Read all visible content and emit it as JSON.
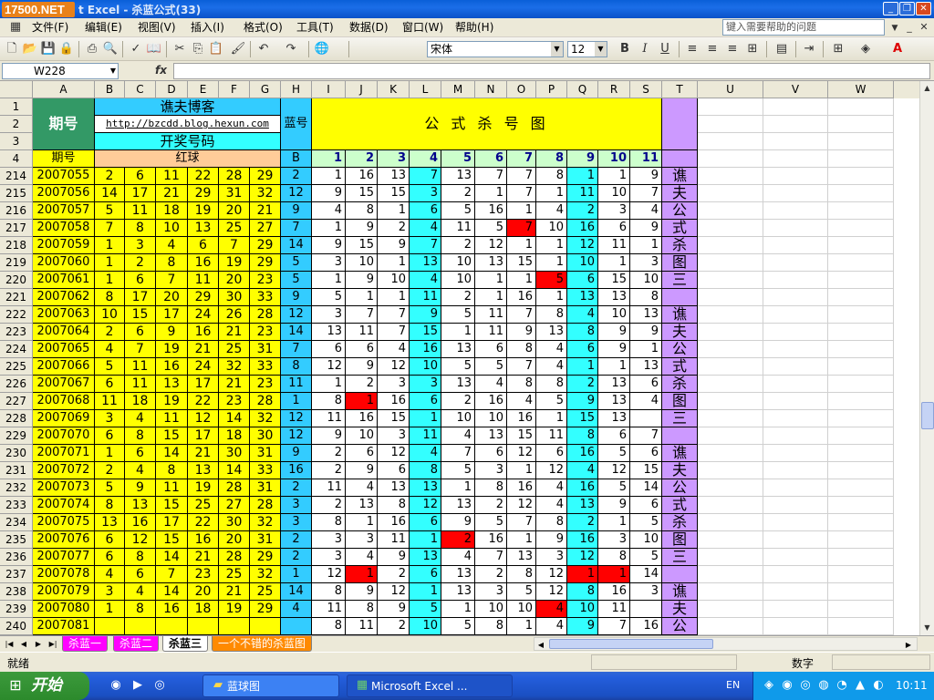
{
  "window": {
    "brand": "17500.NET",
    "title": "t Excel - 杀蓝公式(33)"
  },
  "menu": {
    "items": [
      "文件(F)",
      "编辑(E)",
      "视图(V)",
      "插入(I)",
      "格式(O)",
      "工具(T)",
      "数据(D)",
      "窗口(W)",
      "帮助(H)"
    ],
    "help_placeholder": "键入需要帮助的问题"
  },
  "toolbar": {
    "font": "宋体",
    "size": "12",
    "bold": "B",
    "italic": "I",
    "underline": "U"
  },
  "formula": {
    "cell_ref": "W228",
    "fx": "fx",
    "value": ""
  },
  "columns": [
    "A",
    "B",
    "C",
    "D",
    "E",
    "F",
    "G",
    "H",
    "I",
    "J",
    "K",
    "L",
    "M",
    "N",
    "O",
    "P",
    "Q",
    "R",
    "S",
    "T",
    "U",
    "V",
    "W"
  ],
  "header": {
    "r1": "1",
    "r2": "2",
    "r3": "3",
    "r4": "4",
    "period": "期号",
    "blog": "谯夫博客",
    "url": "http://bzcdd.blog.hexun.com",
    "draw": "开奖号码",
    "blue": "蓝号",
    "formula_title": "公 式 杀 号 图",
    "period2": "期号",
    "red": "红球",
    "b": "B",
    "nums": [
      "1",
      "2",
      "3",
      "4",
      "5",
      "6",
      "7",
      "8",
      "9",
      "10",
      "11"
    ]
  },
  "rows": [
    {
      "r": "214",
      "p": "2007055",
      "red": [
        "2",
        "6",
        "11",
        "22",
        "28",
        "29"
      ],
      "b": "2",
      "n": [
        "1",
        "16",
        "13",
        "7",
        "13",
        "7",
        "7",
        "8",
        "1",
        "1",
        "9"
      ],
      "hl": []
    },
    {
      "r": "215",
      "p": "2007056",
      "red": [
        "14",
        "17",
        "21",
        "29",
        "31",
        "32"
      ],
      "b": "12",
      "n": [
        "9",
        "15",
        "15",
        "3",
        "2",
        "1",
        "7",
        "1",
        "11",
        "10",
        "7"
      ],
      "hl": []
    },
    {
      "r": "216",
      "p": "2007057",
      "red": [
        "5",
        "11",
        "18",
        "19",
        "20",
        "21"
      ],
      "b": "9",
      "n": [
        "4",
        "8",
        "1",
        "6",
        "5",
        "16",
        "1",
        "4",
        "2",
        "3",
        "4"
      ],
      "hl": []
    },
    {
      "r": "217",
      "p": "2007058",
      "red": [
        "7",
        "8",
        "10",
        "13",
        "25",
        "27"
      ],
      "b": "7",
      "n": [
        "1",
        "9",
        "2",
        "4",
        "11",
        "5",
        "7",
        "10",
        "16",
        "6",
        "9"
      ],
      "hl": [
        6
      ]
    },
    {
      "r": "218",
      "p": "2007059",
      "red": [
        "1",
        "3",
        "4",
        "6",
        "7",
        "29"
      ],
      "b": "14",
      "n": [
        "9",
        "15",
        "9",
        "7",
        "2",
        "12",
        "1",
        "1",
        "12",
        "11",
        "1"
      ],
      "hl": []
    },
    {
      "r": "219",
      "p": "2007060",
      "red": [
        "1",
        "2",
        "8",
        "16",
        "19",
        "29"
      ],
      "b": "5",
      "n": [
        "3",
        "10",
        "1",
        "13",
        "10",
        "13",
        "15",
        "1",
        "10",
        "1",
        "3"
      ],
      "hl": []
    },
    {
      "r": "220",
      "p": "2007061",
      "red": [
        "1",
        "6",
        "7",
        "11",
        "20",
        "23"
      ],
      "b": "5",
      "n": [
        "1",
        "9",
        "10",
        "4",
        "10",
        "1",
        "1",
        "5",
        "6",
        "15",
        "10"
      ],
      "hl": [
        7
      ]
    },
    {
      "r": "221",
      "p": "2007062",
      "red": [
        "8",
        "17",
        "20",
        "29",
        "30",
        "33"
      ],
      "b": "9",
      "n": [
        "5",
        "1",
        "1",
        "11",
        "2",
        "1",
        "16",
        "1",
        "13",
        "13",
        "8"
      ],
      "hl": []
    },
    {
      "r": "222",
      "p": "2007063",
      "red": [
        "10",
        "15",
        "17",
        "24",
        "26",
        "28"
      ],
      "b": "12",
      "n": [
        "3",
        "7",
        "7",
        "9",
        "5",
        "11",
        "7",
        "8",
        "4",
        "10",
        "13"
      ],
      "hl": []
    },
    {
      "r": "223",
      "p": "2007064",
      "red": [
        "2",
        "6",
        "9",
        "16",
        "21",
        "23"
      ],
      "b": "14",
      "n": [
        "13",
        "11",
        "7",
        "15",
        "1",
        "11",
        "9",
        "13",
        "8",
        "9",
        "9"
      ],
      "hl": []
    },
    {
      "r": "224",
      "p": "2007065",
      "red": [
        "4",
        "7",
        "19",
        "21",
        "25",
        "31"
      ],
      "b": "7",
      "n": [
        "6",
        "6",
        "4",
        "16",
        "13",
        "6",
        "8",
        "4",
        "6",
        "9",
        "1"
      ],
      "hl": []
    },
    {
      "r": "225",
      "p": "2007066",
      "red": [
        "5",
        "11",
        "16",
        "24",
        "32",
        "33"
      ],
      "b": "8",
      "n": [
        "12",
        "9",
        "12",
        "10",
        "5",
        "5",
        "7",
        "4",
        "1",
        "1",
        "13"
      ],
      "hl": []
    },
    {
      "r": "226",
      "p": "2007067",
      "red": [
        "6",
        "11",
        "13",
        "17",
        "21",
        "23"
      ],
      "b": "11",
      "n": [
        "1",
        "2",
        "3",
        "3",
        "13",
        "4",
        "8",
        "8",
        "2",
        "13",
        "6"
      ],
      "hl": []
    },
    {
      "r": "227",
      "p": "2007068",
      "red": [
        "11",
        "18",
        "19",
        "22",
        "23",
        "28"
      ],
      "b": "1",
      "n": [
        "8",
        "1",
        "16",
        "6",
        "2",
        "16",
        "4",
        "5",
        "9",
        "13",
        "4"
      ],
      "hl": [
        1
      ]
    },
    {
      "r": "228",
      "p": "2007069",
      "red": [
        "3",
        "4",
        "11",
        "12",
        "14",
        "32"
      ],
      "b": "12",
      "n": [
        "11",
        "16",
        "15",
        "1",
        "10",
        "10",
        "16",
        "1",
        "15",
        "13",
        ""
      ],
      "hl": []
    },
    {
      "r": "229",
      "p": "2007070",
      "red": [
        "6",
        "8",
        "15",
        "17",
        "18",
        "30"
      ],
      "b": "12",
      "n": [
        "9",
        "10",
        "3",
        "11",
        "4",
        "13",
        "15",
        "11",
        "8",
        "6",
        "7"
      ],
      "hl": []
    },
    {
      "r": "230",
      "p": "2007071",
      "red": [
        "1",
        "6",
        "14",
        "21",
        "30",
        "31"
      ],
      "b": "9",
      "n": [
        "2",
        "6",
        "12",
        "4",
        "7",
        "6",
        "12",
        "6",
        "16",
        "5",
        "6"
      ],
      "hl": []
    },
    {
      "r": "231",
      "p": "2007072",
      "red": [
        "2",
        "4",
        "8",
        "13",
        "14",
        "33"
      ],
      "b": "16",
      "n": [
        "2",
        "9",
        "6",
        "8",
        "5",
        "3",
        "1",
        "12",
        "4",
        "12",
        "15"
      ],
      "hl": []
    },
    {
      "r": "232",
      "p": "2007073",
      "red": [
        "5",
        "9",
        "11",
        "19",
        "28",
        "31"
      ],
      "b": "2",
      "n": [
        "11",
        "4",
        "13",
        "13",
        "1",
        "8",
        "16",
        "4",
        "16",
        "5",
        "14"
      ],
      "hl": []
    },
    {
      "r": "233",
      "p": "2007074",
      "red": [
        "8",
        "13",
        "15",
        "25",
        "27",
        "28"
      ],
      "b": "3",
      "n": [
        "2",
        "13",
        "8",
        "12",
        "13",
        "2",
        "12",
        "4",
        "13",
        "9",
        "6"
      ],
      "hl": []
    },
    {
      "r": "234",
      "p": "2007075",
      "red": [
        "13",
        "16",
        "17",
        "22",
        "30",
        "32"
      ],
      "b": "3",
      "n": [
        "8",
        "1",
        "16",
        "6",
        "9",
        "5",
        "7",
        "8",
        "2",
        "1",
        "5"
      ],
      "hl": []
    },
    {
      "r": "235",
      "p": "2007076",
      "red": [
        "6",
        "12",
        "15",
        "16",
        "20",
        "31"
      ],
      "b": "2",
      "n": [
        "3",
        "3",
        "11",
        "1",
        "2",
        "16",
        "1",
        "9",
        "16",
        "3",
        "10"
      ],
      "hl": [
        4
      ]
    },
    {
      "r": "236",
      "p": "2007077",
      "red": [
        "6",
        "8",
        "14",
        "21",
        "28",
        "29"
      ],
      "b": "2",
      "n": [
        "3",
        "4",
        "9",
        "13",
        "4",
        "7",
        "13",
        "3",
        "12",
        "8",
        "5"
      ],
      "hl": []
    },
    {
      "r": "237",
      "p": "2007078",
      "red": [
        "4",
        "6",
        "7",
        "23",
        "25",
        "32"
      ],
      "b": "1",
      "n": [
        "12",
        "1",
        "2",
        "6",
        "13",
        "2",
        "8",
        "12",
        "1",
        "1",
        "14"
      ],
      "hl": [
        1,
        8,
        9
      ]
    },
    {
      "r": "238",
      "p": "2007079",
      "red": [
        "3",
        "4",
        "14",
        "20",
        "21",
        "25"
      ],
      "b": "14",
      "n": [
        "8",
        "9",
        "12",
        "1",
        "13",
        "3",
        "5",
        "12",
        "8",
        "16",
        "3"
      ],
      "hl": []
    },
    {
      "r": "239",
      "p": "2007080",
      "red": [
        "1",
        "8",
        "16",
        "18",
        "19",
        "29"
      ],
      "b": "4",
      "n": [
        "11",
        "8",
        "9",
        "5",
        "1",
        "10",
        "10",
        "4",
        "10",
        "11",
        ""
      ],
      "hl": [
        7
      ]
    },
    {
      "r": "240",
      "p": "2007081",
      "red": [
        "",
        "",
        "",
        "",
        "",
        "",
        ""
      ],
      "b": "",
      "n": [
        "8",
        "11",
        "2",
        "10",
        "5",
        "8",
        "1",
        "4",
        "9",
        "7",
        "16"
      ],
      "hl": []
    }
  ],
  "vertical_label": [
    "谯",
    "夫",
    "公",
    "式",
    "杀",
    "图",
    "三",
    "",
    "谯",
    "夫",
    "公",
    "式",
    "杀",
    "图",
    "三",
    "",
    "谯",
    "夫",
    "公",
    "式",
    "杀",
    "图",
    "三",
    "",
    "谯",
    "夫",
    "公"
  ],
  "tabs": [
    "杀蓝一",
    "杀蓝二",
    "杀蓝三",
    "一个不错的杀蓝图"
  ],
  "status": {
    "left": "就绪",
    "mode": "数字"
  },
  "taskbar": {
    "start": "开始",
    "tasks": [
      "蓝球图",
      "Microsoft Excel ..."
    ],
    "lang": "EN",
    "time": "10:11"
  },
  "colors": {
    "yellow": "#ffff00",
    "cyan": "#33ccff",
    "teal": "#339966",
    "salmon": "#ffcc99",
    "aqua": "#33ffff",
    "lime": "#ccffcc",
    "purple": "#cc99ff",
    "red": "#ff0000"
  }
}
